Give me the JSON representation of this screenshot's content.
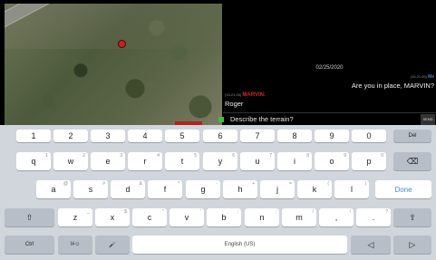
{
  "chat": {
    "date": "02/25/2020",
    "outgoing": {
      "meta": "(15:21:05)",
      "sender": "Me",
      "text": "Are you in place, MARVIN?"
    },
    "incoming": {
      "meta": "(15:21:05)",
      "sender": "MARVIN:",
      "text": "Roger"
    },
    "input_value": "Describe the terrain?",
    "send_label": "SEND"
  },
  "map": {
    "marker_icon": "location-marker-icon"
  },
  "keyboard": {
    "number_row": [
      "1",
      "2",
      "3",
      "4",
      "5",
      "6",
      "7",
      "8",
      "9",
      "0",
      "Del"
    ],
    "row1": [
      {
        "label": "q",
        "hint": "1"
      },
      {
        "label": "w",
        "hint": "2"
      },
      {
        "label": "e",
        "hint": "3"
      },
      {
        "label": "r",
        "hint": "4"
      },
      {
        "label": "t",
        "hint": "5"
      },
      {
        "label": "y",
        "hint": "6"
      },
      {
        "label": "u",
        "hint": "7"
      },
      {
        "label": "i",
        "hint": "8"
      },
      {
        "label": "o",
        "hint": "9"
      },
      {
        "label": "p",
        "hint": "0"
      }
    ],
    "row2": [
      {
        "label": "a",
        "hint": "@"
      },
      {
        "label": "s",
        "hint": "#"
      },
      {
        "label": "d",
        "hint": "&"
      },
      {
        "label": "f",
        "hint": "*"
      },
      {
        "label": "g",
        "hint": "-"
      },
      {
        "label": "h",
        "hint": "+"
      },
      {
        "label": "j",
        "hint": "="
      },
      {
        "label": "k",
        "hint": "("
      },
      {
        "label": "l",
        "hint": ")"
      }
    ],
    "row3": [
      {
        "label": "z",
        "hint": "_"
      },
      {
        "label": "x",
        "hint": "$"
      },
      {
        "label": "c",
        "hint": "\""
      },
      {
        "label": "v",
        "hint": "'"
      },
      {
        "label": "b",
        "hint": ":"
      },
      {
        "label": "n",
        "hint": ";"
      },
      {
        "label": "m",
        "hint": "/"
      }
    ],
    "punct_1": "!",
    "punct_1_main": ",",
    "punct_2": "?",
    "punct_2_main": ".",
    "done_label": "Done",
    "ctrl_label": "Ctrl",
    "symbols_label": "!#☺",
    "space_label": "English (US)",
    "backspace_icon": "⌫",
    "shift_icon": "⇧",
    "mic_icon": "🎤",
    "left_icon": "◁",
    "right_icon": "▷"
  }
}
